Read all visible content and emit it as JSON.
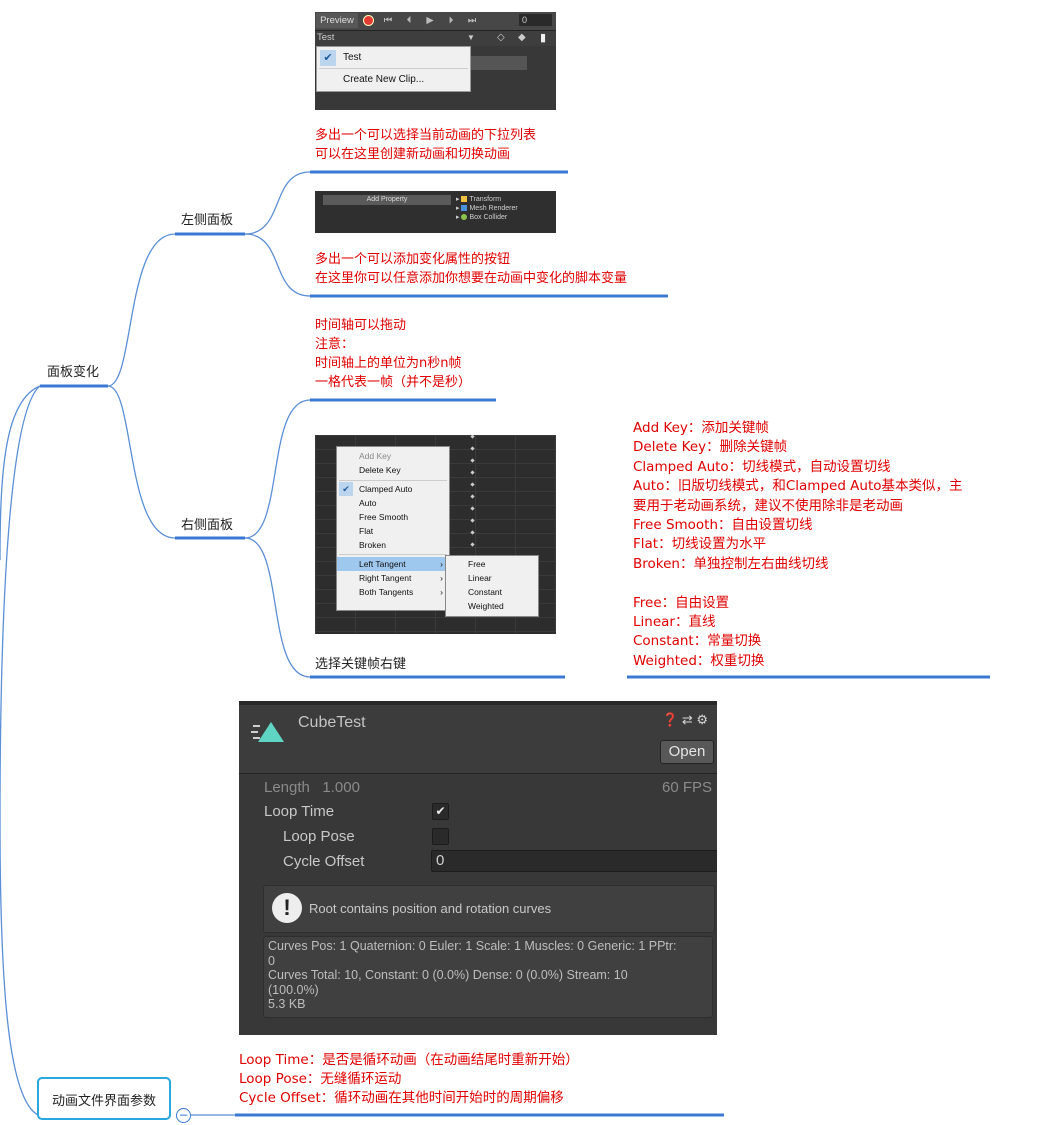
{
  "root": {
    "label": "面板变化",
    "left_panel": {
      "label": "左侧面板",
      "preview_toolbar": {
        "preview_label": "Preview",
        "frame_value": "0",
        "clip_name": "Test",
        "dropdown_items": [
          "Test",
          "Create New Clip..."
        ]
      },
      "note1": [
        "多出一个可以选择当前动画的下拉列表",
        "可以在这里创建新动画和切换动画"
      ],
      "add_property": {
        "button_label": "Add Property",
        "components": [
          "Transform",
          "Mesh Renderer",
          "Box Collider"
        ]
      },
      "note2": [
        "多出一个可以添加变化属性的按钮",
        "在这里你可以任意添加你想要在动画中变化的脚本变量"
      ]
    },
    "right_panel": {
      "label": "右侧面板",
      "note_timeline": [
        "时间轴可以拖动",
        "注意：",
        "时间轴上的单位为n秒n帧",
        "一格代表一帧（并不是秒）"
      ],
      "context_menu": {
        "items": [
          "Add Key",
          "Delete Key",
          "Clamped Auto",
          "Auto",
          "Free Smooth",
          "Flat",
          "Broken",
          "Left Tangent",
          "Right Tangent",
          "Both Tangents"
        ],
        "submenu": [
          "Free",
          "Linear",
          "Constant",
          "Weighted"
        ]
      },
      "caption": "选择关键帧右键",
      "descriptions": [
        "Add Key：添加关键帧",
        "Delete Key：删除关键帧",
        "Clamped Auto：切线模式，自动设置切线",
        "Auto：旧版切线模式，和Clamped Auto基本类似，主",
        "要用于老动画系统，建议不使用除非是老动画",
        "Free Smooth：自由设置切线",
        "Flat：切线设置为水平",
        "Broken：单独控制左右曲线切线",
        "",
        "Free：自由设置",
        "Linear：直线",
        "Constant：常量切换",
        "Weighted：权重切换"
      ]
    }
  },
  "anim_file": {
    "label": "动画文件界面参数",
    "inspector": {
      "title": "CubeTest",
      "open_label": "Open",
      "length_label": "Length",
      "length_value": "1.000",
      "fps": "60 FPS",
      "loop_time": "Loop Time",
      "loop_pose": "Loop Pose",
      "cycle_offset": "Cycle Offset",
      "cycle_offset_value": "0",
      "help_text": "Root contains position and rotation curves",
      "info_lines": [
        "Curves Pos: 1 Quaternion: 0 Euler: 1 Scale: 1 Muscles: 0 Generic: 1 PPtr:",
        "0",
        "Curves Total: 10, Constant: 0 (0.0%) Dense: 0 (0.0%) Stream: 10",
        "(100.0%)",
        "5.3 KB"
      ]
    },
    "notes": [
      "Loop Time：是否是循环动画（在动画结尾时重新开始）",
      "Loop Pose：无缝循环运动",
      "Cycle Offset：循环动画在其他时间开始时的周期偏移"
    ],
    "collapse_symbol": "−"
  },
  "colors": {
    "line": "#5b8fd6",
    "underline": "#3a78d4",
    "note": "#e00000",
    "selected_border": "#29a8e0"
  }
}
